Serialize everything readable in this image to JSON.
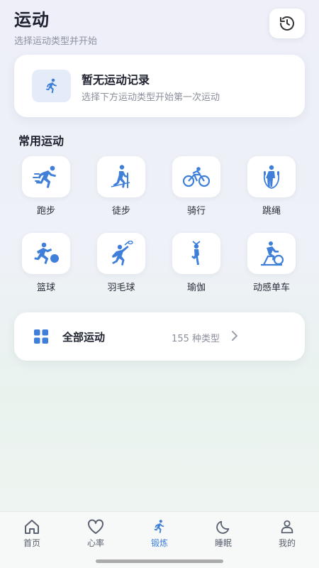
{
  "header": {
    "title": "运动",
    "subtitle": "选择运动类型并开始",
    "history_icon": "history-icon"
  },
  "record": {
    "title": "暂无运动记录",
    "subtitle": "选择下方运动类型开始第一次运动",
    "icon": "running-icon"
  },
  "common": {
    "title": "常用运动",
    "items": [
      {
        "label": "跑步",
        "icon": "running-icon"
      },
      {
        "label": "徒步",
        "icon": "hiking-icon"
      },
      {
        "label": "骑行",
        "icon": "cycling-icon"
      },
      {
        "label": "跳绳",
        "icon": "jump-rope-icon"
      },
      {
        "label": "篮球",
        "icon": "basketball-icon"
      },
      {
        "label": "羽毛球",
        "icon": "badminton-icon"
      },
      {
        "label": "瑜伽",
        "icon": "yoga-icon"
      },
      {
        "label": "动感单车",
        "icon": "spin-bike-icon"
      }
    ]
  },
  "all_sports": {
    "label": "全部运动",
    "count": "155 种类型",
    "icon": "grid-icon"
  },
  "tabbar": {
    "items": [
      {
        "label": "首页",
        "icon": "home-icon",
        "active": false
      },
      {
        "label": "心率",
        "icon": "heart-icon",
        "active": false
      },
      {
        "label": "锻炼",
        "icon": "running-icon",
        "active": true
      },
      {
        "label": "睡眠",
        "icon": "moon-icon",
        "active": false
      },
      {
        "label": "我的",
        "icon": "user-icon",
        "active": false
      }
    ]
  },
  "colors": {
    "accent": "#3f7fd9",
    "icon_bg": "#e4ecfa"
  }
}
